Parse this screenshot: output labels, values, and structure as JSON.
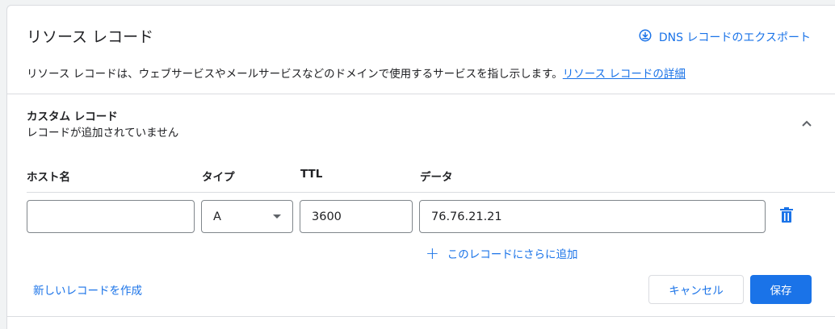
{
  "card": {
    "title": "リソース レコード",
    "export_label": "DNS レコードのエクスポート",
    "export_icon": "download-circle-icon",
    "description": "リソース レコードは、ウェブサービスやメールサービスなどのドメインで使用するサービスを指し示します。",
    "details_link": "リソース レコードの詳細"
  },
  "custom_records": {
    "title": "カスタム レコード",
    "subtitle": "レコードが追加されていません",
    "collapse_icon": "chevron-up-icon"
  },
  "table": {
    "headers": {
      "host": "ホスト名",
      "type": "タイプ",
      "ttl": "TTL",
      "data": "データ"
    },
    "row": {
      "host": "",
      "type": "A",
      "ttl": "3600",
      "data": "76.76.21.21",
      "delete_icon": "trash-icon"
    }
  },
  "actions": {
    "add_more": "このレコードにさらに追加",
    "new_record": "新しいレコードを作成",
    "cancel": "キャンセル",
    "save": "保存"
  },
  "colors": {
    "accent": "#1a73e8",
    "border": "#dadce0",
    "text": "#202124"
  }
}
